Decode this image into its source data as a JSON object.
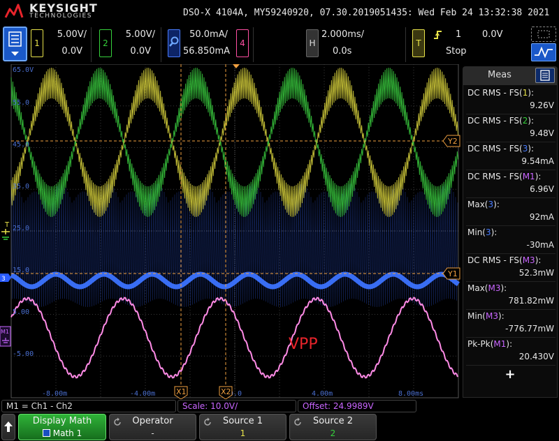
{
  "header": {
    "brand": "KEYSIGHT",
    "brand_sub": "TECHNOLOGIES",
    "title": "DSO-X 4104A, MY59240920, 07.30.2019051435: Wed Feb 24 13:32:38 2021"
  },
  "channels": {
    "ch1": {
      "num": "1",
      "scale": "5.00V/",
      "offset": "0.0V",
      "color": "#e8e34a"
    },
    "ch2": {
      "num": "2",
      "scale": "5.00V/",
      "offset": "0.0V",
      "color": "#36d13c"
    },
    "ch3": {
      "scale": "50.0mA/",
      "offset": "56.850mA",
      "color": "#4a7dff"
    },
    "ch4": {
      "num": "4",
      "color": "#ff4fa3"
    }
  },
  "horizontal": {
    "tag": "H",
    "scale": "2.000ms/",
    "delay": "0.0s"
  },
  "trigger": {
    "tag": "T",
    "source": "1",
    "level": "0.0V",
    "state": "Stop"
  },
  "screen": {
    "y_labels": [
      "65.0V",
      "55.0",
      "45.0",
      "35.0",
      "25.0",
      "15.0",
      "5.00",
      "-5.00"
    ],
    "x_labels": [
      "-8.00m",
      "-4.00m",
      "0.0",
      "4.00m",
      "8.00ms"
    ],
    "cursor_labels": {
      "x1": "X1",
      "x2": "X2",
      "y1": "Y1",
      "y2": "Y2"
    },
    "annotation": "VPP",
    "marker_labels": {
      "trigger": "T",
      "ch3": "3",
      "math": "M1"
    }
  },
  "measurements": {
    "title": "Meas",
    "items": [
      {
        "label": "DC RMS - FS(",
        "src": "1",
        "src_color": "#e8e34a",
        "value": "9.26V"
      },
      {
        "label": "DC RMS - FS(",
        "src": "2",
        "src_color": "#36d13c",
        "value": "9.48V"
      },
      {
        "label": "DC RMS - FS(",
        "src": "3",
        "src_color": "#4a7dff",
        "value": "9.54mA"
      },
      {
        "label": "DC RMS - FS(",
        "src": "M1",
        "src_color": "#c966ff",
        "value": "6.96V"
      },
      {
        "label": "Max(",
        "src": "3",
        "src_color": "#4a7dff",
        "value": "92mA"
      },
      {
        "label": "Min(",
        "src": "3",
        "src_color": "#4a7dff",
        "value": "-30mA"
      },
      {
        "label": "DC RMS - FS(",
        "src": "M3",
        "src_color": "#c966ff",
        "value": "52.3mW"
      },
      {
        "label": "Max(",
        "src": "M3",
        "src_color": "#c966ff",
        "value": "781.82mW"
      },
      {
        "label": "Min(",
        "src": "M3",
        "src_color": "#c966ff",
        "value": "-776.77mW"
      },
      {
        "label": "Pk-Pk(",
        "src": "M1",
        "src_color": "#c966ff",
        "value": "20.430V"
      }
    ],
    "add_symbol": "+"
  },
  "status": {
    "math_def": "M1 = Ch1 - Ch2",
    "scale": "Scale: 10.0V/",
    "offset": "Offset: 24.9989V"
  },
  "softkeys": {
    "display_math": {
      "label": "Display Math",
      "value": "Math 1"
    },
    "operator": {
      "label": "Operator",
      "value": "-"
    },
    "source1": {
      "label": "Source 1",
      "value": "1"
    },
    "source2": {
      "label": "Source 2",
      "value": "2"
    }
  }
}
